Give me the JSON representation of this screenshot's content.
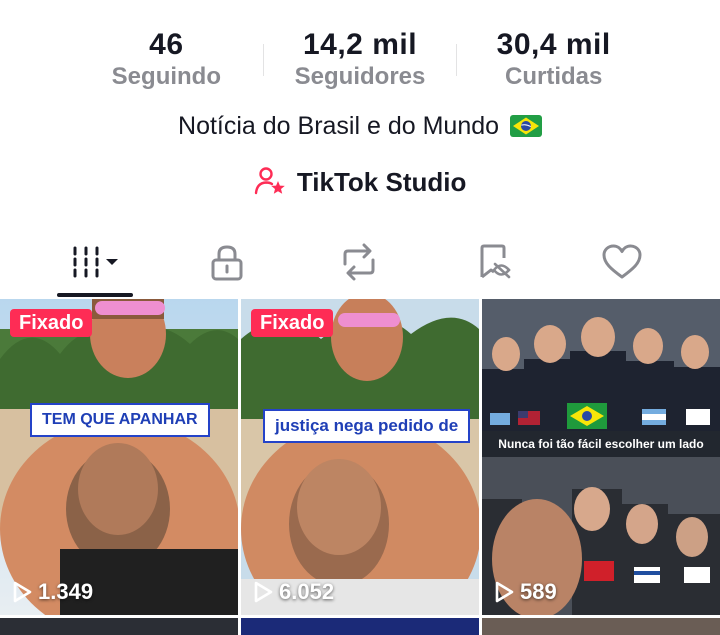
{
  "stats": [
    {
      "value": "46",
      "label": "Seguindo"
    },
    {
      "value": "14,2 mil",
      "label": "Seguidores"
    },
    {
      "value": "30,4 mil",
      "label": "Curtidas"
    }
  ],
  "bio": "Notícia do Brasil e do Mundo",
  "studio_label": "TikTok Studio",
  "tabs": [
    "videos-tab",
    "private-tab",
    "reposts-tab",
    "favorites-tab",
    "liked-tab"
  ],
  "videos": [
    {
      "pinned": "Fixado",
      "caption": "TEM QUE APANHAR",
      "views": "1.349"
    },
    {
      "pinned": "Fixado",
      "caption": "justiça nega pedido de",
      "views": "6.052"
    },
    {
      "caption": "Nunca foi tão fácil  escolher um lado",
      "views": "589"
    }
  ],
  "colors": {
    "accent": "#fe2c55",
    "text": "#161823",
    "muted": "#8a8b91",
    "caption_blue": "#2443c8"
  }
}
